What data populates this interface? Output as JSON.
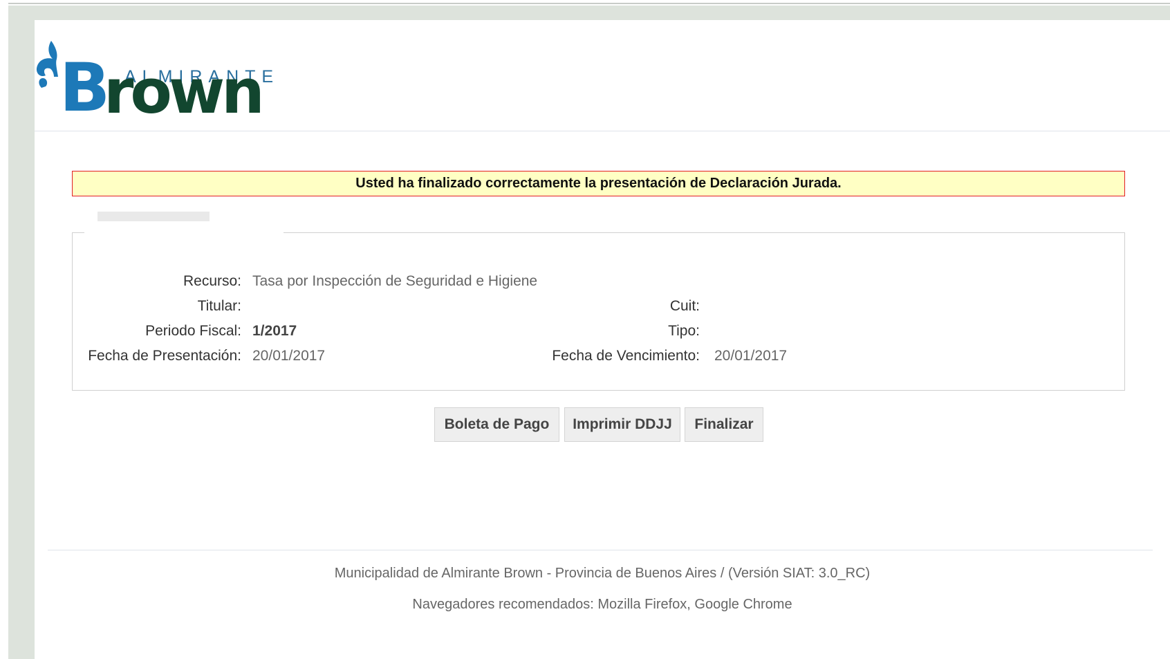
{
  "header": {
    "logo": {
      "word_small": "ALMIRANTE",
      "word_big_b": "B",
      "word_big_rest": "rown"
    }
  },
  "banner": {
    "message": "Usted ha finalizado correctamente la presentación de Declaración Jurada."
  },
  "details": {
    "recurso_label": "Recurso:",
    "recurso_value": "Tasa por Inspección de Seguridad e Higiene",
    "titular_label": "Titular:",
    "titular_value": "",
    "cuit_label": "Cuit:",
    "cuit_value": "",
    "periodo_label": "Periodo Fiscal:",
    "periodo_value": "1/2017",
    "tipo_label": "Tipo:",
    "tipo_value": "",
    "fecha_presentacion_label": "Fecha de Presentación:",
    "fecha_presentacion_value": "20/01/2017",
    "fecha_vencimiento_label": "Fecha de Vencimiento:",
    "fecha_vencimiento_value": "20/01/2017"
  },
  "buttons": {
    "boleta": "Boleta de Pago",
    "imprimir": "Imprimir DDJJ",
    "finalizar": "Finalizar"
  },
  "footer": {
    "line1": "Municipalidad de Almirante Brown - Provincia de Buenos Aires / (Versión SIAT: 3.0_RC)",
    "line2": "Navegadores recomendados: Mozilla Firefox, Google Chrome"
  },
  "colors": {
    "banner_bg": "#ffffc4",
    "banner_border": "#e21c24",
    "logo_blue": "#1d79b8",
    "logo_green": "#12462f"
  }
}
